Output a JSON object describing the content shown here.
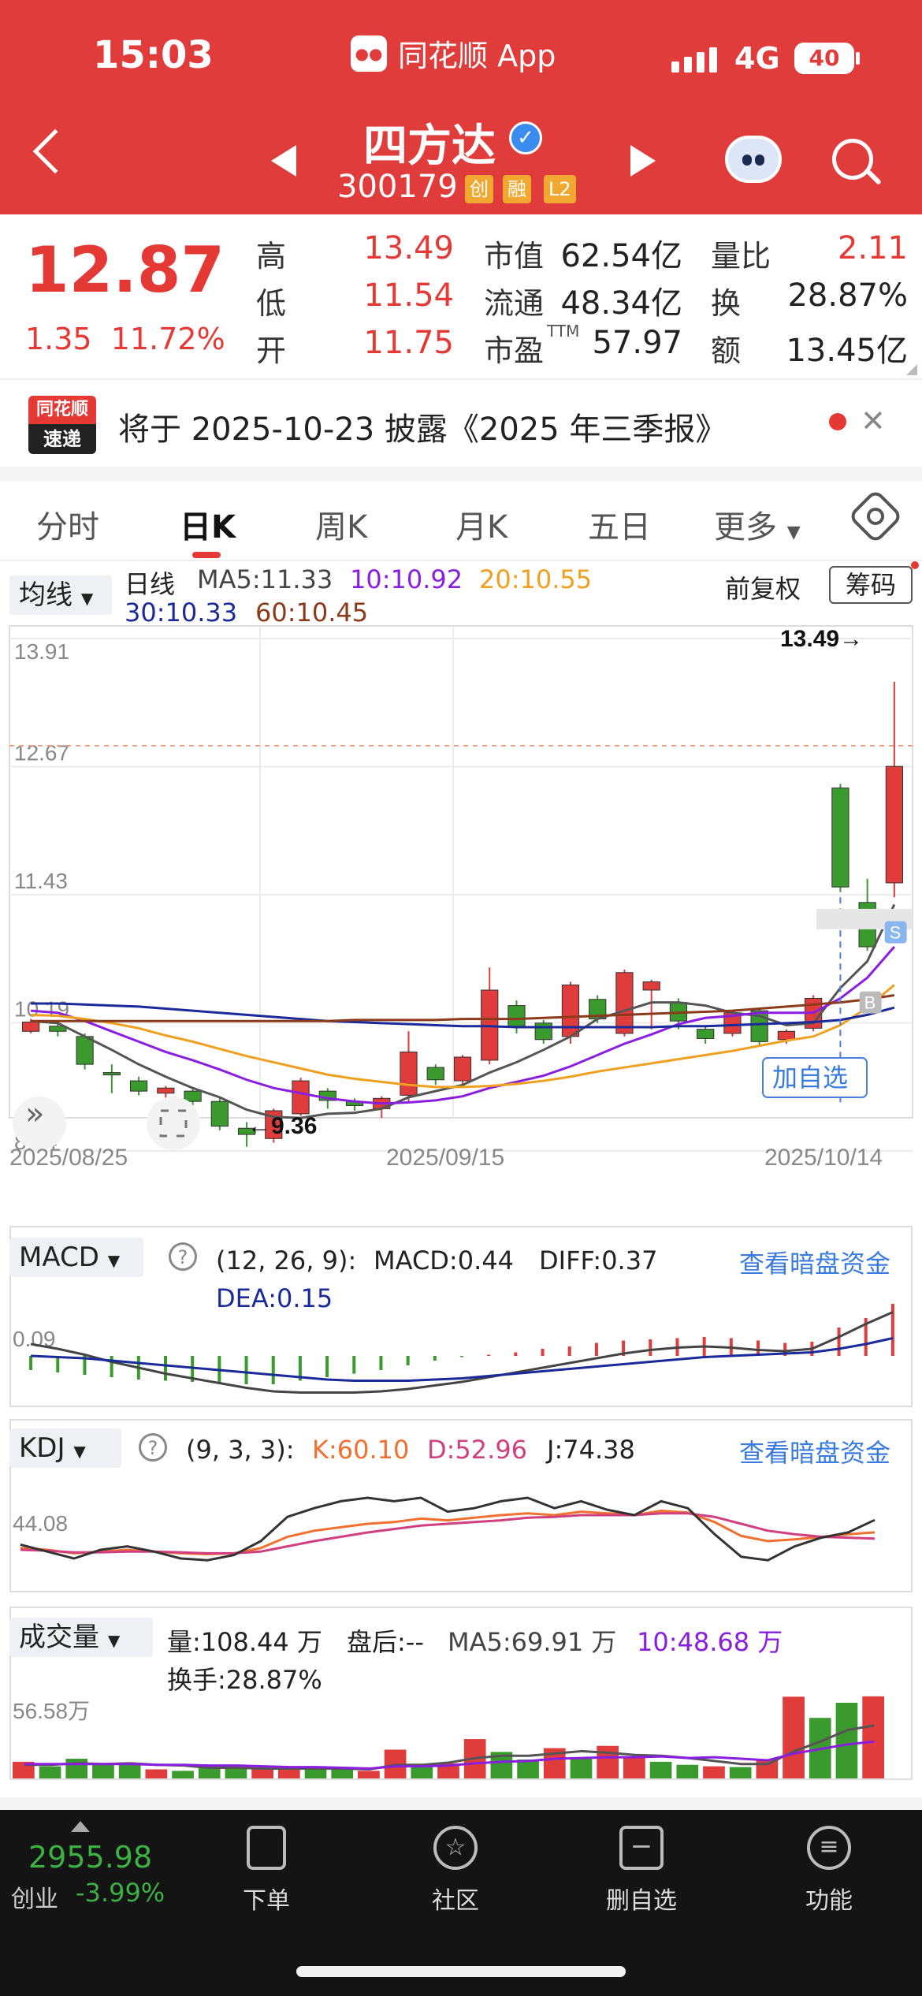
{
  "status_bar": {
    "time": "15:03",
    "app_name": "同花顺 App",
    "network": "4G",
    "battery": "40"
  },
  "header": {
    "stock_name": "四方达",
    "stock_code": "300179",
    "badges": [
      "创",
      "融",
      "L2"
    ]
  },
  "quote": {
    "price": "12.87",
    "change": "1.35",
    "change_pct": "11.72%",
    "rows": [
      {
        "l1": "高",
        "v1": "13.49",
        "l2": "市值",
        "v2": "62.54亿",
        "l3": "量比",
        "v3": "2.11"
      },
      {
        "l1": "低",
        "v1": "11.54",
        "l2": "流通",
        "v2": "48.34亿",
        "l3": "换",
        "v3": "28.87%"
      },
      {
        "l1": "开",
        "v1": "11.75",
        "l2": "市盈",
        "v2": "57.97",
        "l3": "额",
        "v3": "13.45亿"
      }
    ],
    "pe_suffix": "TTM"
  },
  "banner": {
    "logo_top": "同花顺",
    "logo_bottom": "速递",
    "text": "将于 2025-10-23 披露《2025 年三季报》"
  },
  "tabs": [
    "分时",
    "日K",
    "周K",
    "月K",
    "五日",
    "更多"
  ],
  "kline": {
    "indicator_select": "均线",
    "period": "日线",
    "ma5": "MA5:11.33",
    "ma10": "10:10.92",
    "ma20": "20:10.55",
    "ma30": "30:10.33",
    "ma60": "60:10.45",
    "adjust": "前复权",
    "chips": "筹码",
    "y_labels": [
      "13.91",
      "12.67",
      "11.43",
      "10.19",
      "8.94"
    ],
    "high_label": "13.49→",
    "low_label": "←9.36",
    "x_labels": [
      "2025/08/25",
      "2025/09/15",
      "2025/10/14"
    ],
    "add_watch": "加自选",
    "sell_mark": "S",
    "buy_mark": "B"
  },
  "macd": {
    "select": "MACD",
    "params": "(12, 26, 9):",
    "macd": "MACD:0.44",
    "diff": "DIFF:0.37",
    "dea": "DEA:0.15",
    "link": "查看暗盘资金",
    "y_label": "0.09"
  },
  "kdj": {
    "select": "KDJ",
    "params": "(9, 3, 3):",
    "k": "K:60.10",
    "d": "D:52.96",
    "j": "J:74.38",
    "link": "查看暗盘资金",
    "y_label": "44.08"
  },
  "volume": {
    "select": "成交量",
    "vol": "量:108.44 万",
    "after": "盘后:--",
    "ma5": "MA5:69.91 万",
    "ma10": "10:48.68 万",
    "turnover": "换手:28.87%",
    "y_label": "56.58万"
  },
  "footer": {
    "index_value": "2955.98",
    "index_name": "创业",
    "index_change": "-3.99%",
    "nav": [
      {
        "label": "下单",
        "icon": "order-icon"
      },
      {
        "label": "社区",
        "icon": "community-icon"
      },
      {
        "label": "删自选",
        "icon": "remove-watch-icon"
      },
      {
        "label": "功能",
        "icon": "menu-icon"
      }
    ]
  },
  "chart_data": [
    {
      "type": "candlestick",
      "title": "日线",
      "x_range": [
        "2025/08/25",
        "2025/10/14"
      ],
      "ylim": [
        8.94,
        13.91
      ],
      "candles": [
        {
          "o": 10.1,
          "c": 10.19,
          "h": 10.22,
          "l": 10.08
        },
        {
          "o": 10.15,
          "c": 10.1,
          "h": 10.2,
          "l": 10.05
        },
        {
          "o": 10.05,
          "c": 9.78,
          "h": 10.08,
          "l": 9.73
        },
        {
          "o": 9.7,
          "c": 9.68,
          "h": 9.78,
          "l": 9.5
        },
        {
          "o": 9.62,
          "c": 9.52,
          "h": 9.66,
          "l": 9.48
        },
        {
          "o": 9.5,
          "c": 9.55,
          "h": 9.57,
          "l": 9.44
        },
        {
          "o": 9.52,
          "c": 9.42,
          "h": 9.55,
          "l": 9.38
        },
        {
          "o": 9.42,
          "c": 9.18,
          "h": 9.45,
          "l": 9.14
        },
        {
          "o": 9.16,
          "c": 9.1,
          "h": 9.22,
          "l": 8.98
        },
        {
          "o": 9.06,
          "c": 9.33,
          "h": 9.35,
          "l": 9.02
        },
        {
          "o": 9.3,
          "c": 9.62,
          "h": 9.65,
          "l": 9.28
        },
        {
          "o": 9.52,
          "c": 9.43,
          "h": 9.55,
          "l": 9.35
        },
        {
          "o": 9.42,
          "c": 9.38,
          "h": 9.45,
          "l": 9.33
        },
        {
          "o": 9.35,
          "c": 9.45,
          "h": 9.47,
          "l": 9.26
        },
        {
          "o": 9.48,
          "c": 9.9,
          "h": 10.1,
          "l": 9.42
        },
        {
          "o": 9.75,
          "c": 9.63,
          "h": 9.78,
          "l": 9.58
        },
        {
          "o": 9.62,
          "c": 9.85,
          "h": 9.87,
          "l": 9.58
        },
        {
          "o": 9.82,
          "c": 10.5,
          "h": 10.72,
          "l": 9.78
        },
        {
          "o": 10.35,
          "c": 10.15,
          "h": 10.4,
          "l": 10.08
        },
        {
          "o": 10.18,
          "c": 10.02,
          "h": 10.21,
          "l": 9.98
        },
        {
          "o": 10.05,
          "c": 10.55,
          "h": 10.58,
          "l": 9.98
        },
        {
          "o": 10.41,
          "c": 10.22,
          "h": 10.45,
          "l": 10.18
        },
        {
          "o": 10.08,
          "c": 10.67,
          "h": 10.7,
          "l": 10.05
        },
        {
          "o": 10.5,
          "c": 10.58,
          "h": 10.6,
          "l": 10.12
        },
        {
          "o": 10.38,
          "c": 10.2,
          "h": 10.42,
          "l": 10.12
        },
        {
          "o": 10.12,
          "c": 10.03,
          "h": 10.15,
          "l": 9.98
        },
        {
          "o": 10.08,
          "c": 10.28,
          "h": 10.3,
          "l": 10.05
        },
        {
          "o": 10.3,
          "c": 10.0,
          "h": 10.32,
          "l": 9.96
        },
        {
          "o": 10.02,
          "c": 10.1,
          "h": 10.12,
          "l": 9.98
        },
        {
          "o": 10.13,
          "c": 10.42,
          "h": 10.45,
          "l": 10.1
        },
        {
          "o": 12.46,
          "c": 11.5,
          "h": 12.5,
          "l": 11.45
        },
        {
          "o": 11.35,
          "c": 10.92,
          "h": 11.58,
          "l": 10.88
        },
        {
          "o": 11.54,
          "c": 12.67,
          "h": 13.49,
          "l": 11.4
        }
      ],
      "ma": {
        "MA5": [
          10.2,
          10.18,
          10.05,
          9.92,
          9.78,
          9.66,
          9.55,
          9.46,
          9.34,
          9.27,
          9.26,
          9.3,
          9.31,
          9.35,
          9.46,
          9.52,
          9.58,
          9.7,
          9.8,
          9.92,
          10.05,
          10.22,
          10.3,
          10.38,
          10.38,
          10.35,
          10.28,
          10.25,
          10.16,
          10.18,
          10.52,
          10.78,
          11.33
        ],
        "MA10": [
          10.3,
          10.28,
          10.2,
          10.1,
          10.0,
          9.9,
          9.82,
          9.73,
          9.63,
          9.55,
          9.5,
          9.45,
          9.42,
          9.4,
          9.41,
          9.43,
          9.47,
          9.55,
          9.61,
          9.67,
          9.76,
          9.87,
          9.98,
          10.07,
          10.17,
          10.23,
          10.25,
          10.28,
          10.28,
          10.28,
          10.42,
          10.62,
          10.92
        ],
        "MA20": [
          10.26,
          10.25,
          10.22,
          10.18,
          10.13,
          10.06,
          10.0,
          9.93,
          9.86,
          9.8,
          9.74,
          9.68,
          9.64,
          9.61,
          9.58,
          9.56,
          9.56,
          9.57,
          9.59,
          9.62,
          9.66,
          9.71,
          9.75,
          9.79,
          9.83,
          9.87,
          9.91,
          9.96,
          10.01,
          10.05,
          10.16,
          10.33,
          10.55
        ],
        "MA30": [
          10.37,
          10.37,
          10.36,
          10.35,
          10.34,
          10.32,
          10.3,
          10.28,
          10.26,
          10.24,
          10.22,
          10.2,
          10.19,
          10.18,
          10.17,
          10.16,
          10.15,
          10.15,
          10.14,
          10.14,
          10.14,
          10.14,
          10.14,
          10.14,
          10.15,
          10.15,
          10.16,
          10.17,
          10.18,
          10.19,
          10.21,
          10.26,
          10.33
        ],
        "MA60": [
          10.2,
          10.2,
          10.2,
          10.2,
          10.2,
          10.2,
          10.2,
          10.2,
          10.2,
          10.2,
          10.2,
          10.2,
          10.21,
          10.21,
          10.21,
          10.21,
          10.22,
          10.22,
          10.22,
          10.23,
          10.24,
          10.25,
          10.26,
          10.27,
          10.28,
          10.29,
          10.3,
          10.32,
          10.34,
          10.36,
          10.38,
          10.41,
          10.45
        ]
      }
    },
    {
      "type": "bar",
      "title": "MACD",
      "values": [
        -0.12,
        -0.14,
        -0.16,
        -0.18,
        -0.2,
        -0.21,
        -0.22,
        -0.23,
        -0.24,
        -0.24,
        -0.21,
        -0.18,
        -0.15,
        -0.12,
        -0.08,
        -0.04,
        -0.01,
        0.01,
        0.03,
        0.06,
        0.08,
        0.11,
        0.13,
        0.14,
        0.15,
        0.16,
        0.15,
        0.13,
        0.11,
        0.12,
        0.24,
        0.32,
        0.44
      ],
      "series": [
        {
          "name": "DIFF",
          "values": [
            0.1,
            0.06,
            0.01,
            -0.05,
            -0.1,
            -0.15,
            -0.19,
            -0.23,
            -0.27,
            -0.3,
            -0.31,
            -0.31,
            -0.31,
            -0.3,
            -0.28,
            -0.25,
            -0.22,
            -0.18,
            -0.14,
            -0.1,
            -0.06,
            -0.02,
            0.02,
            0.05,
            0.07,
            0.08,
            0.07,
            0.05,
            0.04,
            0.06,
            0.16,
            0.27,
            0.37
          ]
        },
        {
          "name": "DEA",
          "values": [
            0.0,
            -0.01,
            -0.02,
            -0.04,
            -0.06,
            -0.08,
            -0.1,
            -0.12,
            -0.14,
            -0.16,
            -0.18,
            -0.2,
            -0.21,
            -0.21,
            -0.21,
            -0.2,
            -0.19,
            -0.17,
            -0.15,
            -0.13,
            -0.11,
            -0.09,
            -0.07,
            -0.05,
            -0.03,
            -0.01,
            0.0,
            0.01,
            0.02,
            0.03,
            0.06,
            0.1,
            0.15
          ]
        }
      ]
    },
    {
      "type": "line",
      "title": "KDJ",
      "ylim": [
        0,
        100
      ],
      "series": [
        {
          "name": "K",
          "values": [
            42,
            40,
            36,
            38,
            40,
            38,
            36,
            35,
            36,
            42,
            55,
            62,
            66,
            70,
            72,
            76,
            74,
            77,
            80,
            82,
            80,
            84,
            82,
            80,
            85,
            83,
            72,
            56,
            50,
            52,
            55,
            58,
            60.1
          ]
        },
        {
          "name": "D",
          "values": [
            40,
            39,
            37,
            37,
            38,
            38,
            37,
            36,
            36,
            38,
            44,
            50,
            55,
            60,
            64,
            68,
            70,
            72,
            74,
            77,
            78,
            80,
            80,
            80,
            82,
            82,
            78,
            70,
            62,
            58,
            55,
            54,
            52.96
          ]
        },
        {
          "name": "J",
          "values": [
            46,
            38,
            30,
            40,
            44,
            38,
            30,
            28,
            34,
            50,
            78,
            88,
            96,
            100,
            96,
            100,
            84,
            88,
            96,
            100,
            88,
            96,
            86,
            80,
            96,
            88,
            58,
            32,
            28,
            44,
            54,
            60,
            74.38
          ]
        }
      ]
    },
    {
      "type": "bar",
      "title": "成交量",
      "values": [
        22,
        16,
        26,
        18,
        18,
        12,
        10,
        15,
        14,
        12,
        14,
        12,
        13,
        10,
        38,
        18,
        20,
        52,
        35,
        25,
        40,
        27,
        43,
        28,
        22,
        18,
        16,
        15,
        25,
        108,
        80,
        100,
        108.44
      ],
      "series": [
        {
          "name": "MA5",
          "values": [
            18,
            18,
            20,
            19,
            20,
            18,
            17,
            14,
            14,
            13,
            13,
            13,
            13,
            12,
            18,
            18,
            21,
            27,
            30,
            30,
            33,
            36,
            34,
            31,
            30,
            27,
            23,
            19,
            19,
            36,
            49,
            64,
            69.91
          ]
        },
        {
          "name": "10",
          "values": [
            19,
            19,
            19,
            19,
            19,
            18,
            18,
            17,
            17,
            16,
            15,
            15,
            14,
            13,
            16,
            16,
            17,
            20,
            22,
            23,
            26,
            27,
            28,
            28,
            29,
            27,
            28,
            26,
            24,
            33,
            39,
            45,
            48.68
          ]
        }
      ]
    }
  ]
}
